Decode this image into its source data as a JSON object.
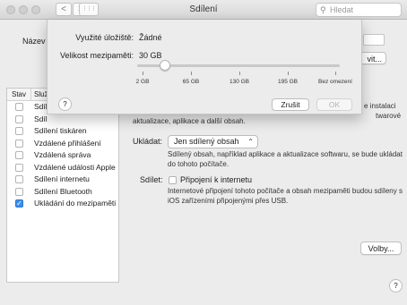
{
  "window": {
    "title": "Sdílení",
    "search_placeholder": "Hledat",
    "back_glyph": "<",
    "forward_glyph": ">",
    "grid_glyph": "⋮⋮⋮"
  },
  "background": {
    "name_label": "Název",
    "edit_button_partial": "vit...",
    "services_header": {
      "status": "Stav",
      "service": "Služ"
    },
    "services": [
      {
        "label": "Sdíl",
        "checked": false
      },
      {
        "label": "Sdíl",
        "checked": false
      },
      {
        "label": "Sdílení tiskáren",
        "checked": false
      },
      {
        "label": "Vzdálené přihlášení",
        "checked": false
      },
      {
        "label": "Vzdálená správa",
        "checked": false
      },
      {
        "label": "Vzdálené události Apple",
        "checked": false
      },
      {
        "label": "Sdílení internetu",
        "checked": false
      },
      {
        "label": "Sdílení Bluetooth",
        "checked": false
      },
      {
        "label": "Ukládání do mezipaměti",
        "checked": true
      }
    ],
    "desc_top_partial_1": "e instalaci",
    "desc_top_partial_2": "twarové",
    "desc_top_partial_3": "aktualizace, aplikace a další obsah.",
    "cache_label": "Ukládat:",
    "cache_value": "Jen sdílený obsah",
    "cache_desc": "Sdílený obsah, například aplikace a aktualizace softwaru, se bude ukládat do tohoto počítače.",
    "share_label": "Sdílet:",
    "share_checkbox_label": "Připojení k internetu",
    "share_desc": "Internetové připojení tohoto počítače a obsah mezipaměti budou sdíleny s iOS zařízeními připojenými přes USB.",
    "options_button": "Volby...",
    "help_glyph": "?"
  },
  "sheet": {
    "used_label": "Využité úložiště:",
    "used_value": "Žádné",
    "size_label": "Velikost mezipaměti:",
    "size_value": "30 GB",
    "slider": {
      "value": "30 GB",
      "ticks": [
        "2 GB",
        "65 GB",
        "130 GB",
        "195 GB",
        "Bez omezení"
      ]
    },
    "help_glyph": "?",
    "cancel_button": "Zrušit",
    "ok_button": "OK"
  },
  "colors": {
    "checkbox_checked": "#3b8ff2"
  }
}
